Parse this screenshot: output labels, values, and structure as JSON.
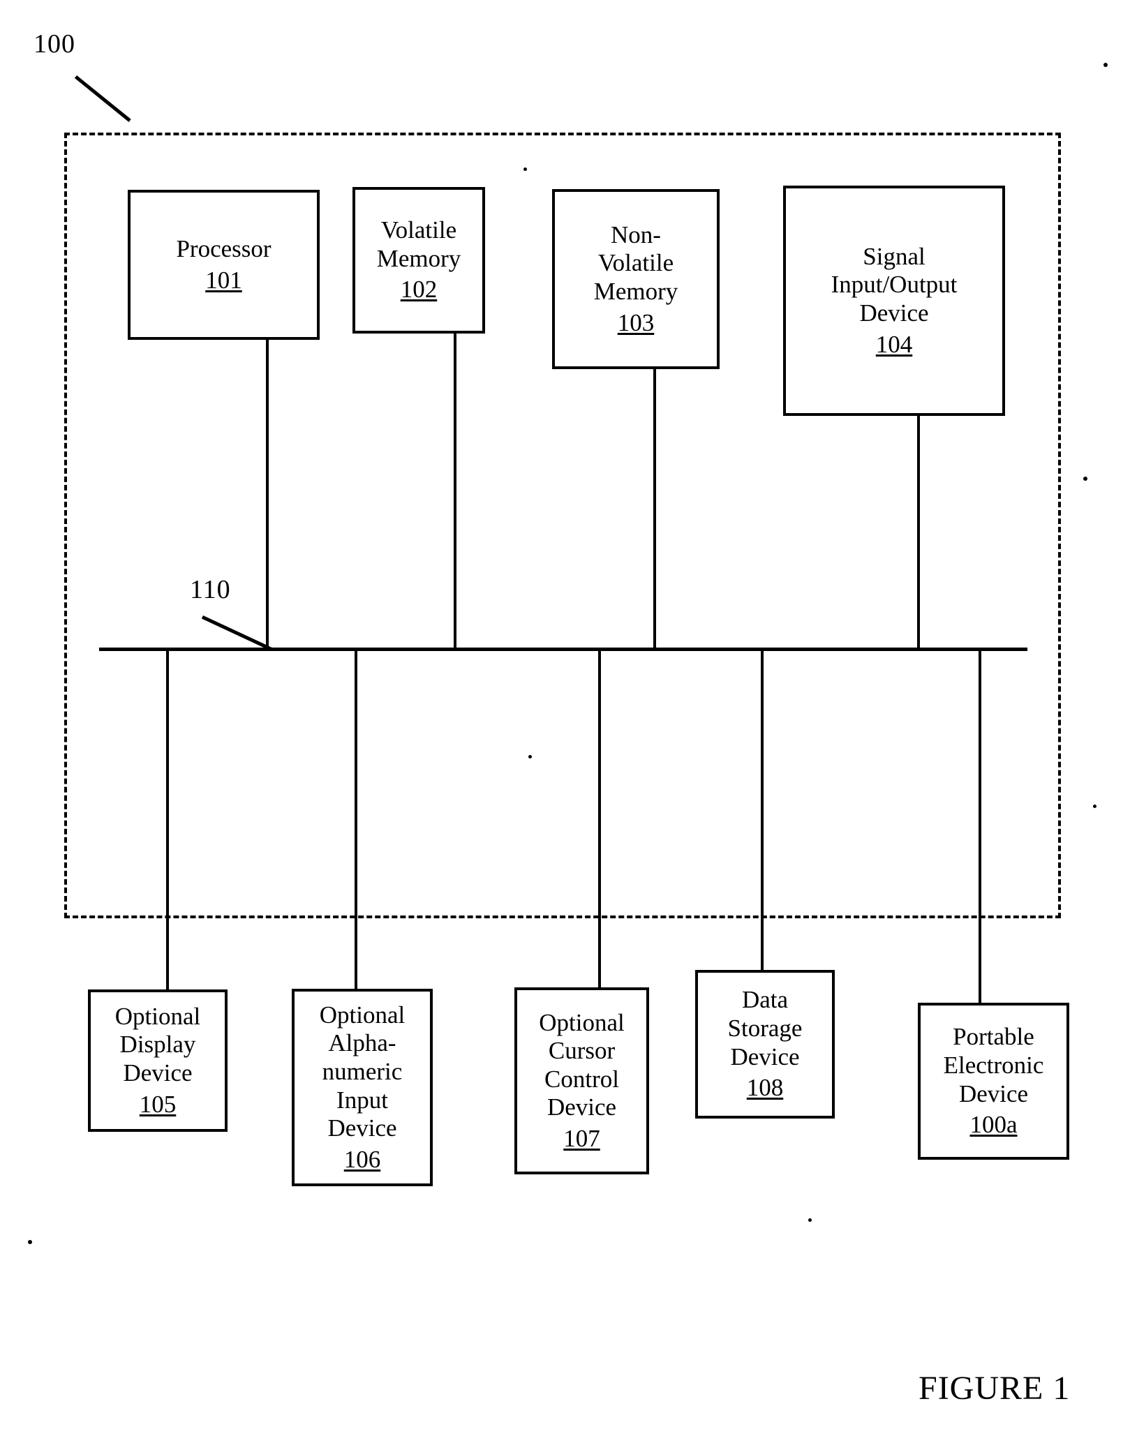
{
  "figure": {
    "caption": "FIGURE 1",
    "system_callout": "100",
    "bus_callout": "110"
  },
  "colors": {
    "ink": "#000000",
    "paper": "#ffffff"
  },
  "internal_units": [
    {
      "id": "processor",
      "label": "Processor",
      "ref": "101"
    },
    {
      "id": "volatile-memory",
      "label": "Volatile\nMemory",
      "ref": "102"
    },
    {
      "id": "non-volatile-memory",
      "label": "Non-\nVolatile\nMemory",
      "ref": "103"
    },
    {
      "id": "signal-io-device",
      "label": "Signal\nInput/Output\nDevice",
      "ref": "104"
    }
  ],
  "external_units": [
    {
      "id": "optional-display-device",
      "label": "Optional\nDisplay\nDevice",
      "ref": "105"
    },
    {
      "id": "optional-alphanumeric-input-device",
      "label": "Optional\nAlpha-\nnumeric\nInput\nDevice",
      "ref": "106"
    },
    {
      "id": "optional-cursor-control-device",
      "label": "Optional\nCursor\nControl\nDevice",
      "ref": "107"
    },
    {
      "id": "data-storage-device",
      "label": "Data\nStorage\nDevice",
      "ref": "108"
    },
    {
      "id": "portable-electronic-device",
      "label": "Portable\nElectronic\nDevice",
      "ref": "100a"
    }
  ]
}
